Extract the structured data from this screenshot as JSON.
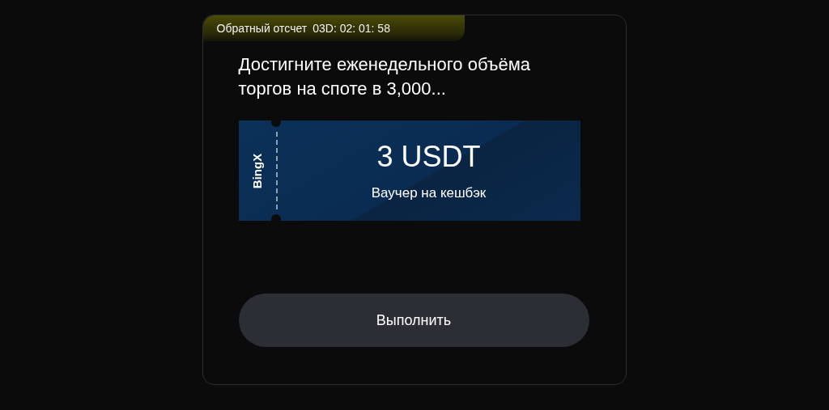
{
  "countdown": {
    "label": "Обратный отсчет",
    "time": "03D: 02: 01: 58"
  },
  "task": {
    "title": "Достигните еженедельного объёма торгов на споте в 3,000..."
  },
  "voucher": {
    "brand": "BingX",
    "amount": "3 USDT",
    "type": "Ваучер на кешбэк"
  },
  "button": {
    "label": "Выполнить"
  }
}
